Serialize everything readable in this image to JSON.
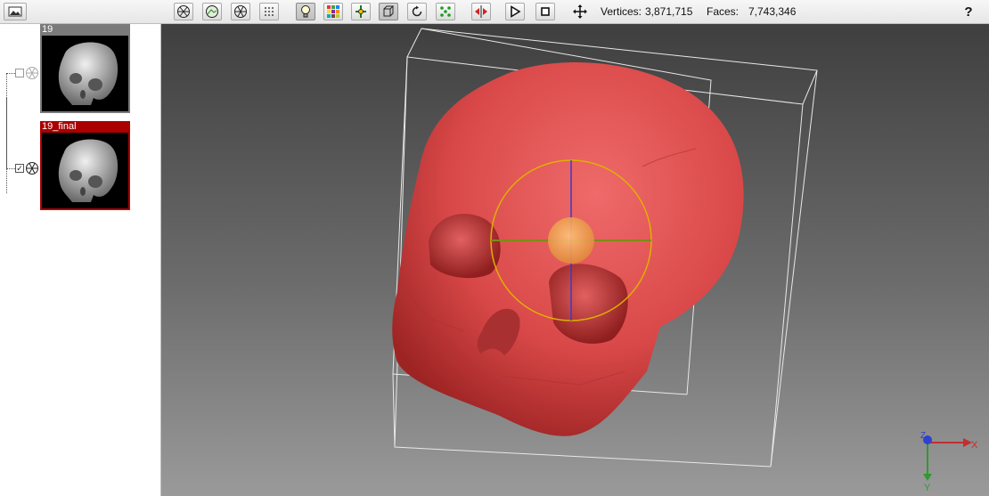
{
  "toolbar": {
    "vertices_label": "Vertices:",
    "vertices_value": "3,871,715",
    "faces_label": "Faces:",
    "faces_value": "7,743,346",
    "help_label": "?"
  },
  "layers": [
    {
      "name": "19",
      "visible": false,
      "selected": false
    },
    {
      "name": "19_final",
      "visible": true,
      "selected": true
    }
  ],
  "viewport": {
    "model_color": "#d94848",
    "axis_labels": {
      "x": "X",
      "y": "Y",
      "z": "Z"
    }
  },
  "colors": {
    "selected_layer": "#aa0000",
    "unselected_layer": "#7a7a7a",
    "trackball": "#e0b000"
  },
  "icons": [
    "snapshot-icon",
    "wireframe-icon",
    "textured-icon",
    "smooth-icon",
    "points-icon",
    "light-icon",
    "color-grid-icon",
    "pick-icon",
    "box-icon",
    "rotate-icon",
    "vertex-select-icon",
    "delete-icon",
    "play-icon",
    "stop-icon",
    "move-icon",
    "help-icon"
  ]
}
